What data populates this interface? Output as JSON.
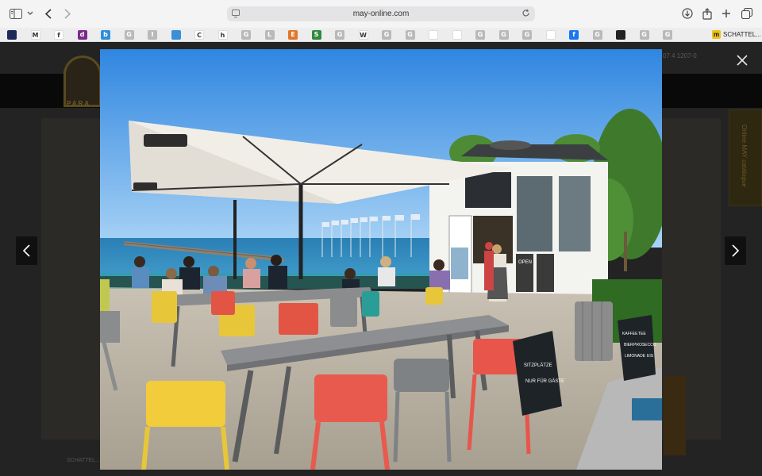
{
  "browser": {
    "address": "may-online.com",
    "favorites_label": "SCHATTEL...",
    "favorites_label_logo": "m",
    "favorites": [
      {
        "letter": "",
        "color": "#1d2a5a",
        "icon": "shield-favicon"
      },
      {
        "letter": "M",
        "color": "#ffffff",
        "icon": "gmail-favicon"
      },
      {
        "letter": "f",
        "color": "#ffffff",
        "icon": "f-favicon"
      },
      {
        "letter": "d",
        "color": "#7a2a8c",
        "icon": "d-favicon"
      },
      {
        "letter": "b",
        "color": "#2d8fd9",
        "icon": "b-favicon"
      },
      {
        "letter": "G",
        "color": "#b9b9b9",
        "icon": "generic-favicon"
      },
      {
        "letter": "I",
        "color": "#b9b9b9",
        "icon": "generic-favicon"
      },
      {
        "letter": "",
        "color": "#3a8fd6",
        "icon": "globe-favicon"
      },
      {
        "letter": "C",
        "color": "#ffffff",
        "icon": "c-favicon"
      },
      {
        "letter": "h",
        "color": "#ffffff",
        "icon": "h-favicon"
      },
      {
        "letter": "G",
        "color": "#b9b9b9",
        "icon": "generic-favicon"
      },
      {
        "letter": "L",
        "color": "#b9b9b9",
        "icon": "generic-favicon"
      },
      {
        "letter": "E",
        "color": "#e2762a",
        "icon": "e-favicon"
      },
      {
        "letter": "S",
        "color": "#2e8b3e",
        "icon": "s-favicon"
      },
      {
        "letter": "G",
        "color": "#b9b9b9",
        "icon": "generic-favicon"
      },
      {
        "letter": "W",
        "color": "#ffffff",
        "icon": "wikipedia-favicon"
      },
      {
        "letter": "G",
        "color": "#b9b9b9",
        "icon": "generic-favicon"
      },
      {
        "letter": "G",
        "color": "#b9b9b9",
        "icon": "generic-favicon"
      },
      {
        "letter": "",
        "color": "#ffffff",
        "icon": "emblem-favicon"
      },
      {
        "letter": "",
        "color": "#ffffff",
        "icon": "emblem-favicon"
      },
      {
        "letter": "G",
        "color": "#b9b9b9",
        "icon": "generic-favicon"
      },
      {
        "letter": "G",
        "color": "#b9b9b9",
        "icon": "generic-favicon"
      },
      {
        "letter": "G",
        "color": "#b9b9b9",
        "icon": "generic-favicon"
      },
      {
        "letter": "",
        "color": "#ffffff",
        "icon": "red-bird-favicon"
      },
      {
        "letter": "f",
        "color": "#1877f2",
        "icon": "facebook-favicon"
      },
      {
        "letter": "G",
        "color": "#b9b9b9",
        "icon": "generic-favicon"
      },
      {
        "letter": "",
        "color": "#222222",
        "icon": "dark-favicon"
      },
      {
        "letter": "G",
        "color": "#b9b9b9",
        "icon": "generic-favicon"
      },
      {
        "letter": "G",
        "color": "#b9b9b9",
        "icon": "generic-favicon"
      }
    ]
  },
  "page_behind": {
    "logo_text": "PARA",
    "side_tab": "Online MAY catalogue",
    "footer_text": "SCHATTEL...",
    "top_right_text": "07 4 1207-0"
  },
  "lightbox": {
    "photo_description_icon": "cafe-terrace-photo",
    "sign_open": "OPEN",
    "sign_board_1": [
      "SITZPLÄTZE",
      "NUR FÜR GÄSTE"
    ],
    "sign_board_2": [
      "KAFFEE",
      "TEE",
      "BIER",
      "PROSECCO",
      "LIMONADE",
      "EIS"
    ]
  },
  "colors": {
    "toolbar_bg": "#f4f4f5",
    "overlay_bg": "#1f1f1f",
    "sky": "#4f9fe6",
    "sea": "#2e86b8"
  }
}
